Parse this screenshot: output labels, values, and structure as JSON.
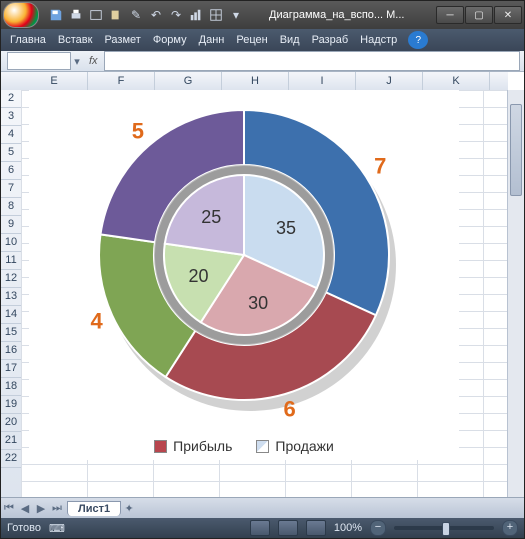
{
  "title": "Диаграмма_на_вспо... M...",
  "ribbon": [
    "Главна",
    "Вставк",
    "Размет",
    "Форму",
    "Данн",
    "Рецен",
    "Вид",
    "Разраб",
    "Надстр"
  ],
  "namebox": "",
  "fx_label": "fx",
  "columns": [
    "E",
    "F",
    "G",
    "H",
    "I",
    "J",
    "K"
  ],
  "rows": [
    "2",
    "3",
    "4",
    "5",
    "6",
    "7",
    "8",
    "9",
    "10",
    "11",
    "12",
    "13",
    "14",
    "15",
    "16",
    "17",
    "18",
    "19",
    "20",
    "21",
    "22"
  ],
  "legend": {
    "profit": "Прибыль",
    "sales": "Продажи"
  },
  "sheet_tab": "Лист1",
  "status_ready": "Готово",
  "zoom": "100%",
  "chart_data": {
    "type": "pie",
    "title": "",
    "series": [
      {
        "name": "Продажи",
        "ring": "inner",
        "values": [
          35,
          30,
          20,
          25
        ],
        "labels": [
          "35",
          "30",
          "20",
          "25"
        ],
        "colors": [
          "#c9dcef",
          "#d9a8ae",
          "#c7e0b0",
          "#c6b9db"
        ]
      },
      {
        "name": "Прибыль",
        "ring": "outer",
        "values": [
          7,
          6,
          4,
          5
        ],
        "labels": [
          "7",
          "6",
          "4",
          "5"
        ],
        "colors": [
          "#3d70ad",
          "#a74a51",
          "#7fa554",
          "#6d5a99"
        ]
      }
    ],
    "legend": [
      "Прибыль",
      "Продажи"
    ]
  }
}
